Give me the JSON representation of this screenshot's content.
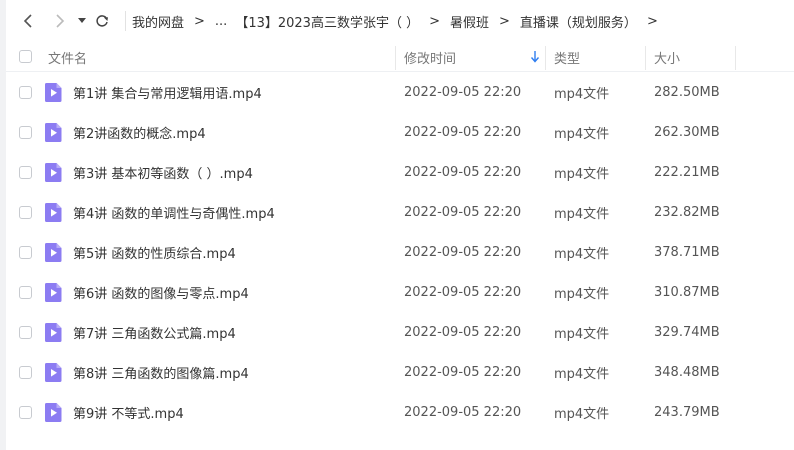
{
  "nav": {
    "back_icon": "chevron-left-icon",
    "forward_icon": "chevron-right-icon",
    "dropdown_icon": "caret-down-icon",
    "refresh_icon": "refresh-icon"
  },
  "breadcrumb": {
    "items": [
      "我的网盘",
      "...",
      "【13】2023高三数学张宇（ ）",
      "暑假班",
      "直播课（规划服务）"
    ],
    "separator": ">"
  },
  "columns": {
    "name": "文件名",
    "modified": "修改时间",
    "type": "类型",
    "size": "大小"
  },
  "files": [
    {
      "name": "第1讲 集合与常用逻辑用语.mp4",
      "modified": "2022-09-05 22:20",
      "type": "mp4文件",
      "size": "282.50MB"
    },
    {
      "name": "第2讲函数的概念.mp4",
      "modified": "2022-09-05 22:20",
      "type": "mp4文件",
      "size": "262.30MB"
    },
    {
      "name": "第3讲 基本初等函数（ ）.mp4",
      "modified": "2022-09-05 22:20",
      "type": "mp4文件",
      "size": "222.21MB"
    },
    {
      "name": "第4讲 函数的单调性与奇偶性.mp4",
      "modified": "2022-09-05 22:20",
      "type": "mp4文件",
      "size": "232.82MB"
    },
    {
      "name": "第5讲 函数的性质综合.mp4",
      "modified": "2022-09-05 22:20",
      "type": "mp4文件",
      "size": "378.71MB"
    },
    {
      "name": "第6讲 函数的图像与零点.mp4",
      "modified": "2022-09-05 22:20",
      "type": "mp4文件",
      "size": "310.87MB"
    },
    {
      "name": "第7讲 三角函数公式篇.mp4",
      "modified": "2022-09-05 22:20",
      "type": "mp4文件",
      "size": "329.74MB"
    },
    {
      "name": "第8讲 三角函数的图像篇.mp4",
      "modified": "2022-09-05 22:20",
      "type": "mp4文件",
      "size": "348.48MB"
    },
    {
      "name": "第9讲 不等式.mp4",
      "modified": "2022-09-05 22:20",
      "type": "mp4文件",
      "size": "243.79MB"
    }
  ],
  "colors": {
    "video_icon": "#8c7cf2",
    "sort_arrow": "#2f7ef0"
  }
}
